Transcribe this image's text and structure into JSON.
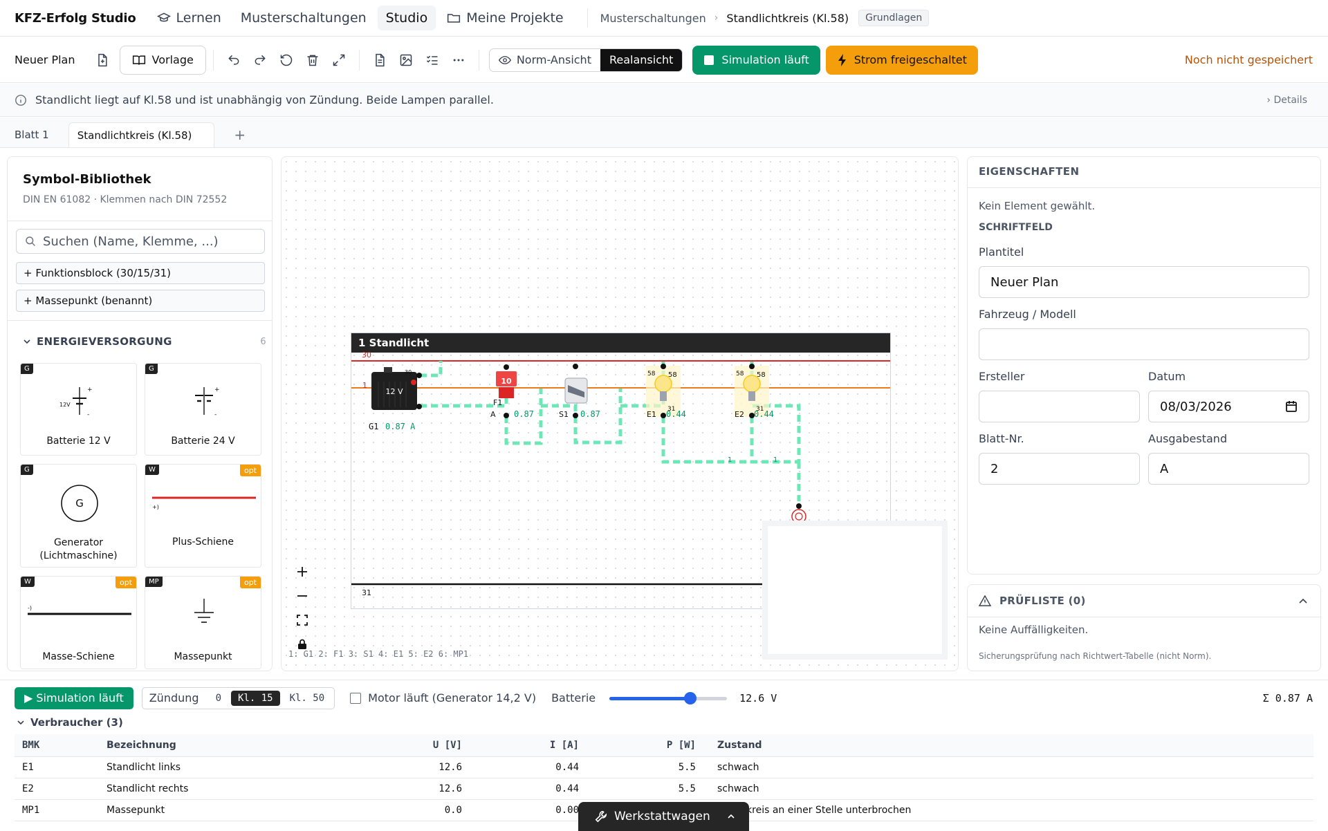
{
  "app": {
    "brand": "KFZ-Erfolg Studio"
  },
  "nav": {
    "items": [
      {
        "label": "Lernen",
        "icon": "graduation-cap-icon"
      },
      {
        "label": "Musterschaltungen"
      },
      {
        "label": "Studio",
        "active": true
      },
      {
        "label": "Meine Projekte",
        "icon": "folder-icon"
      }
    ]
  },
  "breadcrumb": {
    "parent": "Musterschaltungen",
    "current": "Standlichtkreis (Kl.58)",
    "badge": "Grundlagen"
  },
  "toolbar": {
    "plan_name": "Neuer Plan",
    "template_label": "Vorlage",
    "view_norm": "Norm-Ansicht",
    "view_real": "Realansicht",
    "sim_label": "Simulation läuft",
    "power_label": "Strom freigeschaltet",
    "save_state": "Noch nicht gespeichert"
  },
  "infobar": {
    "text": "Standlicht liegt auf Kl.58 und ist unabhängig von Zündung. Beide Lampen parallel.",
    "details": "Details"
  },
  "sheets": {
    "tabs": [
      "Blatt 1",
      "Standlichtkreis (Kl.58)"
    ],
    "add": "+"
  },
  "library": {
    "title": "Symbol-Bibliothek",
    "subtitle": "DIN EN 61082 · Klemmen nach DIN 72552",
    "search_placeholder": "Suchen (Name, Klemme, ...)",
    "buttons": [
      "+ Funktionsblock (30/15/31)",
      "+ Massepunkt (benannt)"
    ],
    "category": {
      "name": "ENERGIEVERSORGUNG",
      "count": "6"
    },
    "cards": [
      {
        "label": "Batterie 12 V",
        "tag": "G",
        "symbol_text": "12V"
      },
      {
        "label": "Batterie 24 V",
        "tag": "G"
      },
      {
        "label": "Generator (Lichtmaschine)",
        "tag": "G",
        "symbol_text": "G"
      },
      {
        "label": "Plus-Schiene",
        "tag": "W",
        "opt": "opt",
        "symbol_text": "+)"
      },
      {
        "label": "Masse-Schiene",
        "tag": "W",
        "opt": "opt",
        "symbol_text": "-)"
      },
      {
        "label": "Massepunkt",
        "tag": "MP",
        "opt": "opt"
      }
    ]
  },
  "canvas": {
    "frame_title": "1 Standlicht",
    "rail_top_label": "30",
    "rail_bottom_label": "31",
    "row_marker": "1",
    "battery_text": "12 V",
    "battery_terminal": "30",
    "fuse_text": "10",
    "components": [
      {
        "id": "G1",
        "current": "0.87 A"
      },
      {
        "id": "F1",
        "current": "0.87",
        "pin": "A"
      },
      {
        "id": "S1",
        "current": "0.87"
      },
      {
        "id": "E1",
        "current": "0.44",
        "pins": [
          "58",
          "58",
          "31"
        ]
      },
      {
        "id": "E2",
        "current": "0.44",
        "pins": [
          "58",
          "58",
          "31"
        ]
      }
    ],
    "netlist": "1: G1  2: F1  3: S1  4: E1  5: E2  6: MP1"
  },
  "properties": {
    "title": "EIGENSCHAFTEN",
    "no_selection": "Kein Element gewählt.",
    "section": "SCHRIFTFELD",
    "plantitel_label": "Plantitel",
    "plantitel_value": "Neuer Plan",
    "fahrzeug_label": "Fahrzeug / Modell",
    "fahrzeug_value": "",
    "ersteller_label": "Ersteller",
    "ersteller_value": "",
    "datum_label": "Datum",
    "datum_value": "08/03/2026",
    "blatt_label": "Blatt-Nr.",
    "blatt_value": "2",
    "ausgabe_label": "Ausgabestand",
    "ausgabe_value": "A"
  },
  "checklist": {
    "title": "PRÜFLISTE (0)",
    "empty": "Keine Auffälligkeiten.",
    "note": "Sicherungsprüfung nach Richtwert-Tabelle (nicht Norm)."
  },
  "simbar": {
    "run_label": "▶ Simulation läuft",
    "ignition_label": "Zündung",
    "ignition_options": [
      "0",
      "Kl. 15",
      "Kl. 50"
    ],
    "ignition_selected": "Kl. 15",
    "motor_label": "Motor läuft (Generator 14,2 V)",
    "battery_label": "Batterie",
    "battery_value": "12.6 V",
    "battery_level": 0.69,
    "sum_current": "Σ 0.87 A"
  },
  "consumers": {
    "title": "Verbraucher (3)",
    "columns": [
      "BMK",
      "Bezeichnung",
      "U [V]",
      "I [A]",
      "P [W]",
      "Zustand"
    ],
    "rows": [
      {
        "bmk": "E1",
        "name": "Standlicht links",
        "u": "12.6",
        "i": "0.44",
        "p": "5.5",
        "state": "schwach",
        "state_type": "ok"
      },
      {
        "bmk": "E2",
        "name": "Standlicht rechts",
        "u": "12.6",
        "i": "0.44",
        "p": "5.5",
        "state": "schwach",
        "state_type": "ok"
      },
      {
        "bmk": "MP1",
        "name": "Massepunkt",
        "u": "0.0",
        "i": "0.00",
        "p": "",
        "state": "Stromkreis an einer Stelle unterbrochen",
        "state_type": "warn"
      }
    ]
  },
  "drawer": {
    "label": "Werkstattwagen"
  },
  "colors": {
    "accent_green": "#059669",
    "accent_orange": "#f59e0b",
    "rail_plus": "#dc2626",
    "wire": "#ea7a1a",
    "flow": "#6ee7b7"
  }
}
